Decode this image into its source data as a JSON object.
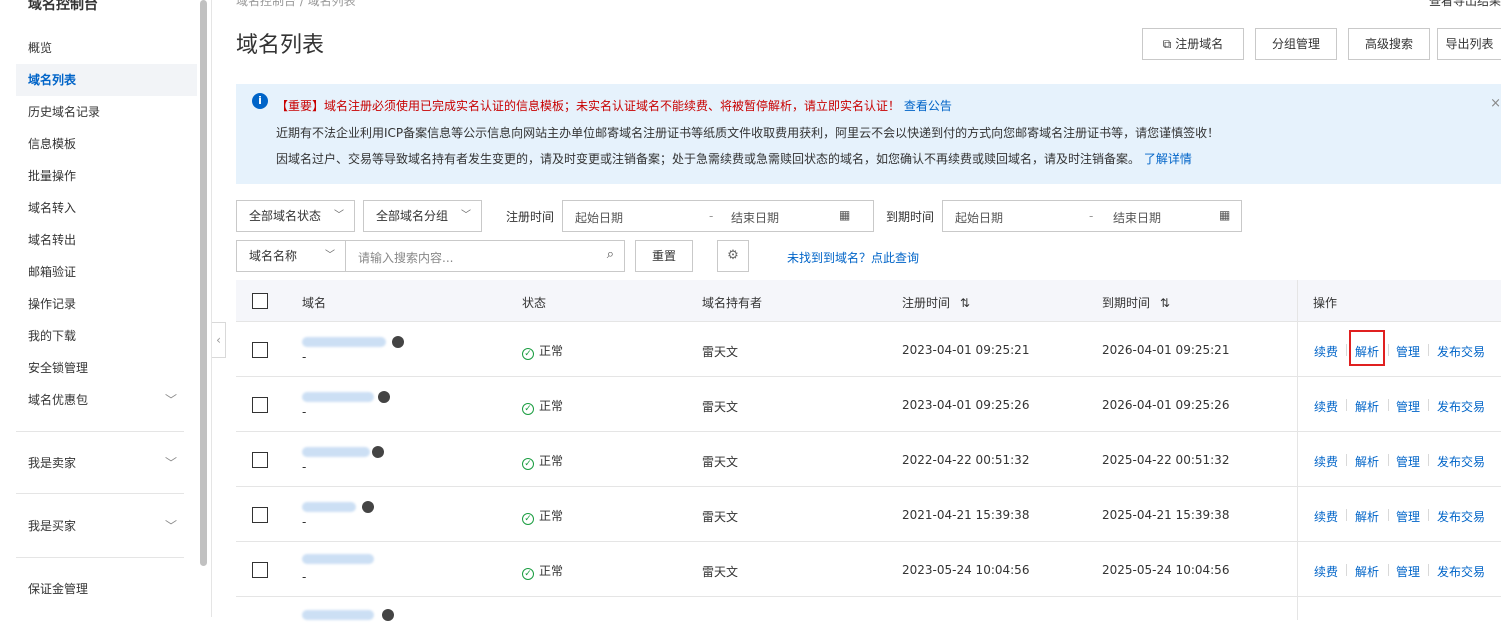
{
  "sidebar": {
    "title": "域名控制台",
    "items": [
      {
        "label": "概览"
      },
      {
        "label": "域名列表"
      },
      {
        "label": "历史域名记录"
      },
      {
        "label": "信息模板"
      },
      {
        "label": "批量操作"
      },
      {
        "label": "域名转入"
      },
      {
        "label": "域名转出"
      },
      {
        "label": "邮箱验证"
      },
      {
        "label": "操作记录"
      },
      {
        "label": "我的下载"
      },
      {
        "label": "安全锁管理"
      },
      {
        "label": "域名优惠包"
      }
    ],
    "groups": [
      {
        "label": "我是卖家"
      },
      {
        "label": "我是买家"
      }
    ],
    "bottom": {
      "label": "保证金管理"
    }
  },
  "header": {
    "breadcrumb": "域名控制台  /  域名列表",
    "top_right": "查看导出结果",
    "title": "域名列表",
    "buttons": {
      "register": "注册域名",
      "group": "分组管理",
      "advanced": "高级搜索",
      "export": "导出列表"
    }
  },
  "notice": {
    "line1_prefix": "【重要】域名注册必须使用已完成实名认证的信息模板；未实名认证域名不能续费、将被暂停解析，请立即实名认证！",
    "line1_link": "查看公告",
    "line2": "近期有不法企业利用ICP备案信息等公示信息向网站主办单位邮寄域名注册证书等纸质文件收取费用获利，阿里云不会以快递到付的方式向您邮寄域名注册证书等，请您谨慎签收！",
    "line3_prefix": "因域名过户、交易等导致域名持有者发生变更的，请及时变更或注销备案；处于急需续费或急需赎回状态的域名，如您确认不再续费或赎回域名，请及时注销备案。",
    "line3_link": "了解详情"
  },
  "filters": {
    "status_select": "全部域名状态",
    "group_select": "全部域名分组",
    "reg_time_label": "注册时间",
    "exp_time_label": "到期时间",
    "start_date_ph": "起始日期",
    "end_date_ph": "结束日期",
    "range_sep": "-",
    "field_select": "域名名称",
    "search_placeholder": "请输入搜索内容...",
    "reset": "重置",
    "not_found_link": "未找到到域名？点此查询"
  },
  "table": {
    "headers": {
      "domain": "域名",
      "status": "状态",
      "holder": "域名持有者",
      "reg_time": "注册时间",
      "exp_time": "到期时间",
      "ops": "操作"
    },
    "rows": [
      {
        "status": "正常",
        "holder": "雷天文",
        "reg": "2023-04-01 09:25:21",
        "exp": "2026-04-01 09:25:21",
        "sub": "-"
      },
      {
        "status": "正常",
        "holder": "雷天文",
        "reg": "2023-04-01 09:25:26",
        "exp": "2026-04-01 09:25:26",
        "sub": "-"
      },
      {
        "status": "正常",
        "holder": "雷天文",
        "reg": "2022-04-22 00:51:32",
        "exp": "2025-04-22 00:51:32",
        "sub": "-"
      },
      {
        "status": "正常",
        "holder": "雷天文",
        "reg": "2021-04-21 15:39:38",
        "exp": "2025-04-21 15:39:38",
        "sub": "-"
      },
      {
        "status": "正常",
        "holder": "雷天文",
        "reg": "2023-05-24 10:04:56",
        "exp": "2025-05-24 10:04:56",
        "sub": "-"
      }
    ],
    "ops": {
      "renew": "续费",
      "dns": "解析",
      "manage": "管理",
      "publish": "发布交易"
    },
    "sort_icon": "⇅"
  },
  "colors": {
    "accent": "#0064c8",
    "notice_bg": "#e6f2fc",
    "warning": "#c80000",
    "highlight": "#e02020"
  }
}
